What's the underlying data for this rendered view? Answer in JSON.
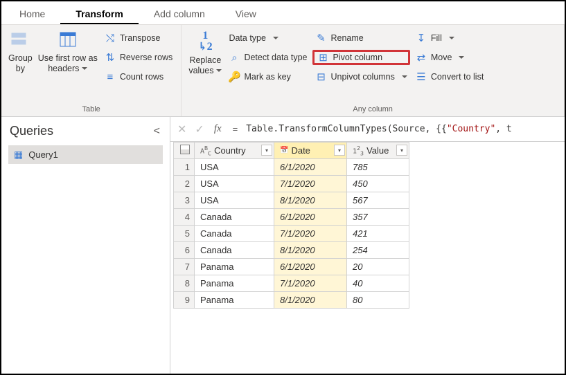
{
  "tabs": {
    "home": "Home",
    "transform": "Transform",
    "add_column": "Add column",
    "view": "View"
  },
  "ribbon": {
    "table_group": {
      "label": "Table",
      "group_by": "Group\nby",
      "use_first_row": "Use first row as\nheaders",
      "transpose": "Transpose",
      "reverse_rows": "Reverse rows",
      "count_rows": "Count rows"
    },
    "any_col_group": {
      "label": "Any column",
      "replace_values": "Replace\nvalues",
      "data_type": "Data type",
      "detect_data_type": "Detect data type",
      "mark_as_key": "Mark as key",
      "rename": "Rename",
      "pivot_column": "Pivot column",
      "unpivot_columns": "Unpivot columns",
      "fill": "Fill",
      "move": "Move",
      "convert_to_list": "Convert to list"
    }
  },
  "queries": {
    "title": "Queries",
    "items": [
      "Query1"
    ]
  },
  "formula": {
    "prefix": "Table.TransformColumnTypes(Source, {{",
    "str": "\"Country\"",
    "suffix": ", t"
  },
  "columns": {
    "country": "Country",
    "date": "Date",
    "value": "Value"
  },
  "rows": [
    {
      "n": "1",
      "country": "USA",
      "date": "6/1/2020",
      "value": "785"
    },
    {
      "n": "2",
      "country": "USA",
      "date": "7/1/2020",
      "value": "450"
    },
    {
      "n": "3",
      "country": "USA",
      "date": "8/1/2020",
      "value": "567"
    },
    {
      "n": "4",
      "country": "Canada",
      "date": "6/1/2020",
      "value": "357"
    },
    {
      "n": "5",
      "country": "Canada",
      "date": "7/1/2020",
      "value": "421"
    },
    {
      "n": "6",
      "country": "Canada",
      "date": "8/1/2020",
      "value": "254"
    },
    {
      "n": "7",
      "country": "Panama",
      "date": "6/1/2020",
      "value": "20"
    },
    {
      "n": "8",
      "country": "Panama",
      "date": "7/1/2020",
      "value": "40"
    },
    {
      "n": "9",
      "country": "Panama",
      "date": "8/1/2020",
      "value": "80"
    }
  ]
}
